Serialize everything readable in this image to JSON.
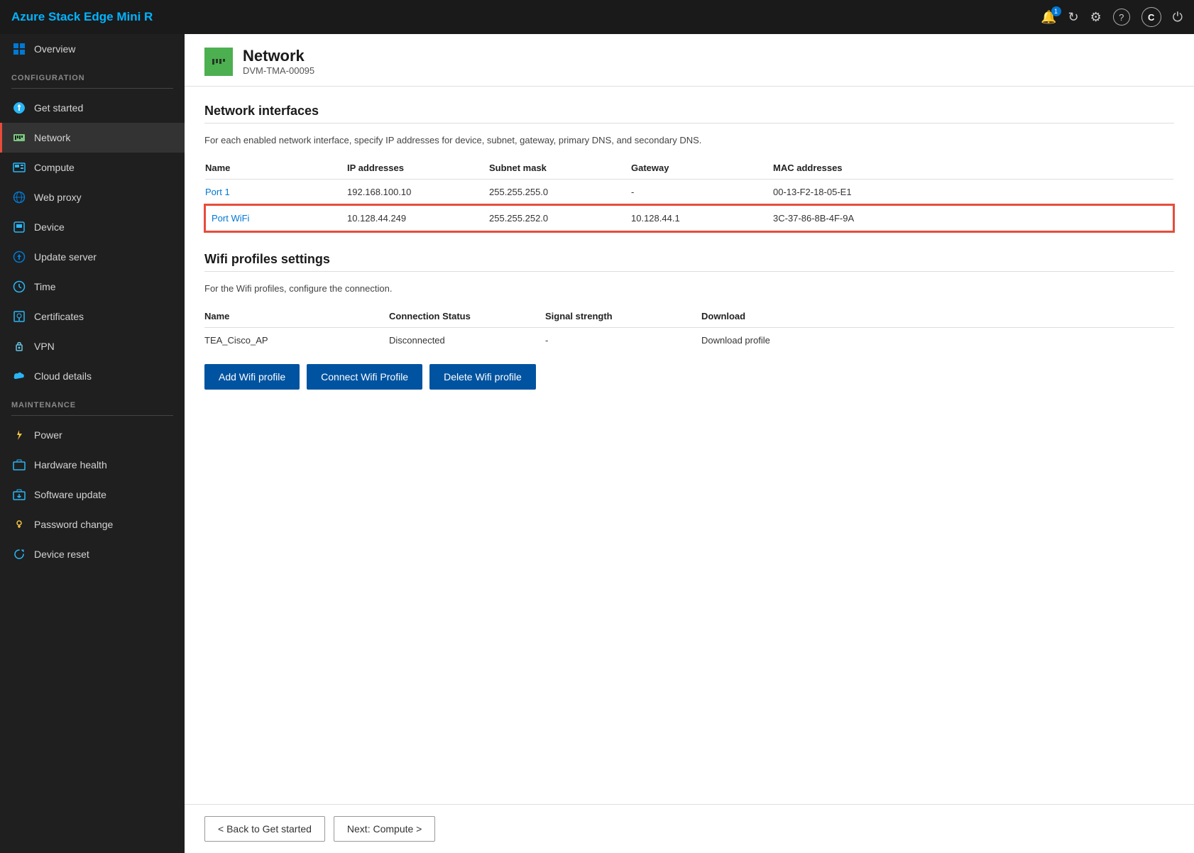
{
  "app": {
    "title": "Azure Stack Edge Mini R"
  },
  "topbar": {
    "title": "Azure Stack Edge Mini R",
    "icons": [
      {
        "name": "notification-icon",
        "symbol": "🔔",
        "badge": "1"
      },
      {
        "name": "refresh-icon",
        "symbol": "↻"
      },
      {
        "name": "settings-icon",
        "symbol": "⚙"
      },
      {
        "name": "help-icon",
        "symbol": "?"
      },
      {
        "name": "account-icon",
        "symbol": "C"
      },
      {
        "name": "power-icon",
        "symbol": "⏻"
      }
    ]
  },
  "sidebar": {
    "config_label": "CONFIGURATION",
    "maintenance_label": "MAINTENANCE",
    "items_config": [
      {
        "id": "overview",
        "label": "Overview",
        "icon": "▦"
      },
      {
        "id": "get-started",
        "label": "Get started",
        "icon": "☁"
      },
      {
        "id": "network",
        "label": "Network",
        "icon": "▦",
        "active": true
      },
      {
        "id": "compute",
        "label": "Compute",
        "icon": "⊞"
      },
      {
        "id": "web-proxy",
        "label": "Web proxy",
        "icon": "⊕"
      },
      {
        "id": "device",
        "label": "Device",
        "icon": "⊞"
      },
      {
        "id": "update-server",
        "label": "Update server",
        "icon": "⊕"
      },
      {
        "id": "time",
        "label": "Time",
        "icon": "⊙"
      },
      {
        "id": "certificates",
        "label": "Certificates",
        "icon": "⊞"
      },
      {
        "id": "vpn",
        "label": "VPN",
        "icon": "🔒"
      },
      {
        "id": "cloud-details",
        "label": "Cloud details",
        "icon": "⚙"
      }
    ],
    "items_maintenance": [
      {
        "id": "power",
        "label": "Power",
        "icon": "⚡"
      },
      {
        "id": "hardware-health",
        "label": "Hardware health",
        "icon": "⊞"
      },
      {
        "id": "software-update",
        "label": "Software update",
        "icon": "⊞"
      },
      {
        "id": "password-change",
        "label": "Password change",
        "icon": "🔑"
      },
      {
        "id": "device-reset",
        "label": "Device reset",
        "icon": "↺"
      }
    ]
  },
  "page": {
    "icon_alt": "Network icon",
    "title": "Network",
    "subtitle": "DVM-TMA-00095"
  },
  "network_interfaces": {
    "section_title": "Network interfaces",
    "section_desc": "For each enabled network interface, specify IP addresses for device, subnet, gateway, primary DNS, and secondary DNS.",
    "columns": [
      "Name",
      "IP addresses",
      "Subnet mask",
      "Gateway",
      "MAC addresses"
    ],
    "rows": [
      {
        "name": "Port 1",
        "ip": "192.168.100.10",
        "subnet": "255.255.255.0",
        "gateway": "-",
        "mac": "00-13-F2-18-05-E1",
        "highlighted": false
      },
      {
        "name": "Port WiFi",
        "ip": "10.128.44.249",
        "subnet": "255.255.252.0",
        "gateway": "10.128.44.1",
        "mac": "3C-37-86-8B-4F-9A",
        "highlighted": true
      }
    ]
  },
  "wifi_profiles": {
    "section_title": "Wifi profiles settings",
    "section_desc": "For the Wifi profiles, configure the connection.",
    "columns": [
      "Name",
      "Connection Status",
      "Signal strength",
      "Download"
    ],
    "rows": [
      {
        "name": "TEA_Cisco_AP",
        "status": "Disconnected",
        "signal": "-",
        "download": "Download profile"
      }
    ],
    "buttons": {
      "add": "Add Wifi profile",
      "connect": "Connect Wifi Profile",
      "delete": "Delete Wifi profile"
    }
  },
  "footer": {
    "back_label": "< Back to Get started",
    "next_label": "Next: Compute >"
  }
}
